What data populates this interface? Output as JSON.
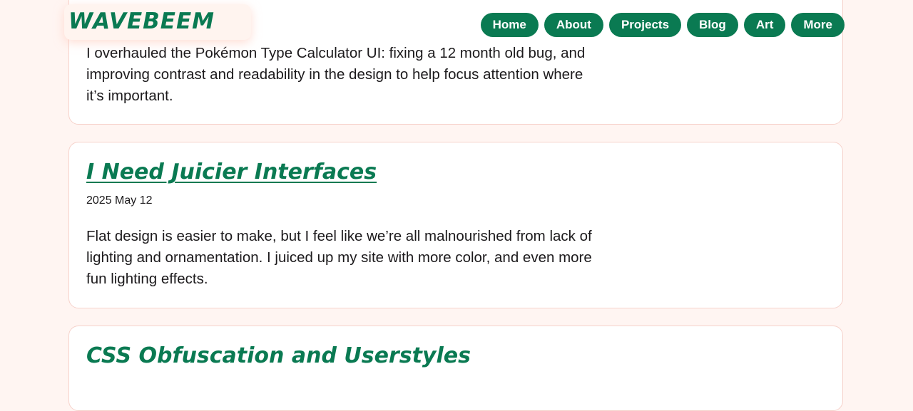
{
  "site": {
    "logo_text": "WAVEBEEM",
    "brand_color": "#0a7a52",
    "background_color": "#fff5f2"
  },
  "nav": {
    "items": [
      "Home",
      "About",
      "Projects",
      "Blog",
      "Art",
      "More"
    ]
  },
  "posts": [
    {
      "title": "",
      "date": "",
      "summary": "I overhauled the Pokémon Type Calculator UI: fixing a 12 month old bug, and improving contrast and readability in the design to help focus attention where it’s important."
    },
    {
      "title": "I Need Juicier Interfaces",
      "date": "2025 May 12",
      "summary": "Flat design is easier to make, but I feel like we’re all malnourished from lack of lighting and ornamentation. I juiced up my site with more color, and even more fun lighting effects."
    },
    {
      "title": "CSS Obfuscation and Userstyles",
      "date": "",
      "summary": ""
    }
  ]
}
